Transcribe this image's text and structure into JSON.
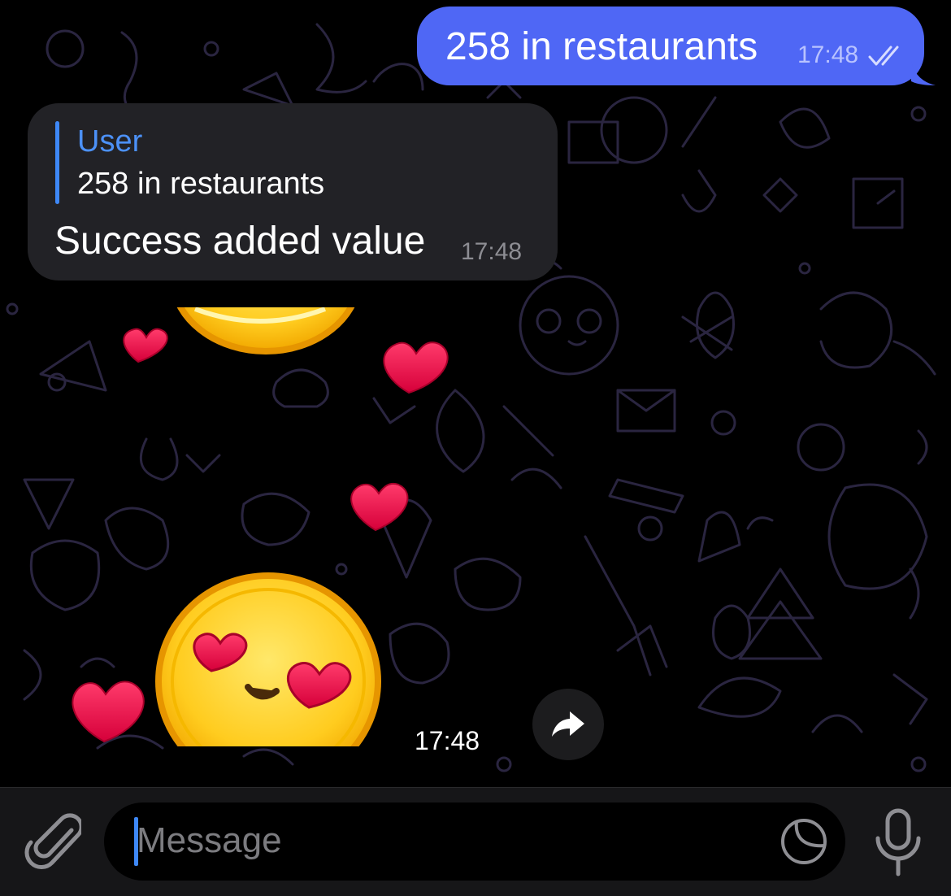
{
  "chat": {
    "outgoing": {
      "text": "258 in restaurants",
      "time": "17:48",
      "status_icon": "double-check-icon"
    },
    "incoming": {
      "reply_name": "User",
      "reply_text": "258 in restaurants",
      "text": "Success added value",
      "time": "17:48"
    },
    "sticker": {
      "description_icon": "heart-eyes-smiley-sticker",
      "time": "17:48",
      "share_icon": "share-arrow-icon"
    }
  },
  "composer": {
    "placeholder": "Message",
    "attach_icon": "paperclip-icon",
    "sticker_icon": "sticker-icon",
    "mic_icon": "microphone-icon"
  },
  "colors": {
    "outgoing_bubble": "#4f67f5",
    "incoming_bubble": "#222226",
    "accent": "#3e88f7",
    "background": "#000000"
  }
}
